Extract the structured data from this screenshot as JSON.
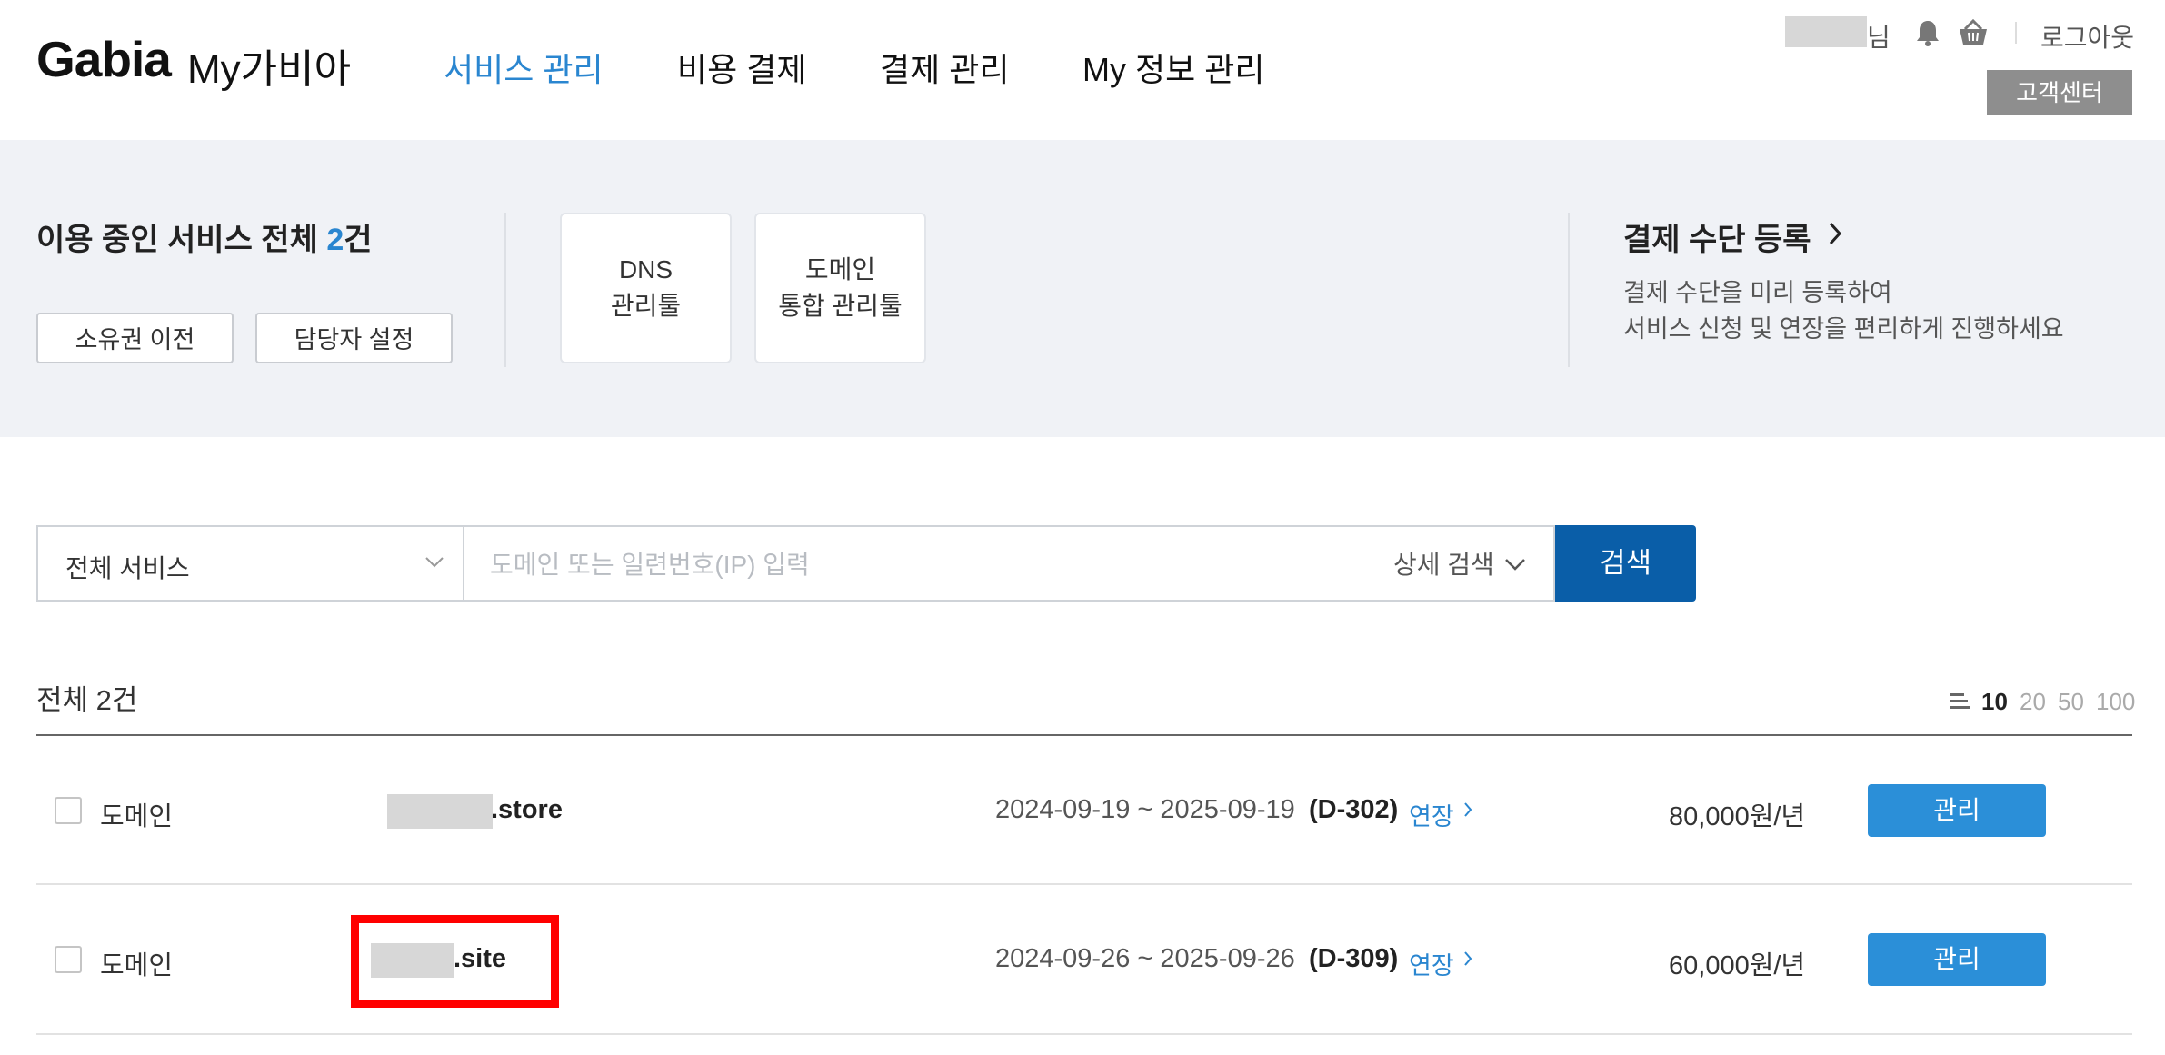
{
  "header": {
    "logo": "Gabia",
    "logo_sub": "My가비아",
    "nav": [
      "서비스 관리",
      "비용 결제",
      "결제 관리",
      "My 정보 관리"
    ],
    "user_suffix": "님",
    "logout": "로그아웃",
    "customer_center": "고객센터"
  },
  "summary": {
    "title_prefix": "이용 중인 서비스 전체 ",
    "count": "2",
    "title_suffix": "건",
    "buttons": [
      "소유권 이전",
      "담당자 설정"
    ],
    "tools": [
      {
        "line1": "DNS",
        "line2": "관리툴"
      },
      {
        "line1": "도메인",
        "line2": "통합 관리툴"
      }
    ],
    "payment": {
      "title": "결제 수단 등록",
      "desc1": "결제 수단을 미리 등록하여",
      "desc2": "서비스 신청 및 연장을 편리하게 진행하세요"
    }
  },
  "search": {
    "select_value": "전체 서비스",
    "placeholder": "도메인 또는 일련번호(IP) 입력",
    "advanced": "상세 검색",
    "button": "검색"
  },
  "list": {
    "total": "전체 2건",
    "page_sizes": [
      "10",
      "20",
      "50",
      "100"
    ],
    "active_page_size": "10",
    "rows": [
      {
        "type": "도메인",
        "domain_tld": ".store",
        "period": "2024-09-19 ~ 2025-09-19",
        "dday": "(D-302)",
        "renew": "연장",
        "price": "80,000원/년",
        "action": "관리"
      },
      {
        "type": "도메인",
        "domain_tld": ".site",
        "period": "2024-09-26 ~ 2025-09-26",
        "dday": "(D-309)",
        "renew": "연장",
        "price": "60,000원/년",
        "action": "관리"
      }
    ]
  },
  "colors": {
    "accent": "#2a86d0",
    "search_button": "#0a5ea8",
    "manage_button": "#2b8fd8",
    "summary_bg": "#f0f2f6",
    "highlight": "#ff0000"
  }
}
